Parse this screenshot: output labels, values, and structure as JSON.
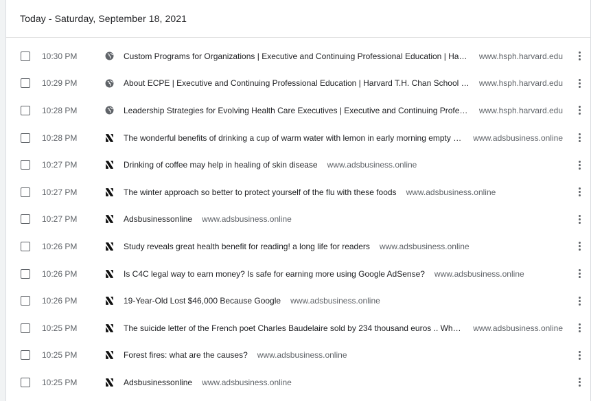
{
  "history": {
    "date_heading": "Today - Saturday, September 18, 2021",
    "rows": [
      {
        "time": "10:30 PM",
        "icon": "globe-icon",
        "title": "Custom Programs for Organizations | Executive and Continuing Professional Education | Harvard T.H. Chan School of Public Health",
        "domain": "www.hsph.harvard.edu"
      },
      {
        "time": "10:29 PM",
        "icon": "globe-icon",
        "title": "About ECPE | Executive and Continuing Professional Education | Harvard T.H. Chan School of Public Health",
        "domain": "www.hsph.harvard.edu"
      },
      {
        "time": "10:28 PM",
        "icon": "globe-icon",
        "title": "Leadership Strategies for Evolving Health Care Executives | Executive and Continuing Professional Education",
        "domain": "www.hsph.harvard.edu"
      },
      {
        "time": "10:28 PM",
        "icon": "adsbusiness-logo-icon",
        "title": "The wonderful benefits of drinking a cup of warm water with lemon in early morning empty stomach",
        "domain": "www.adsbusiness.online"
      },
      {
        "time": "10:27 PM",
        "icon": "adsbusiness-logo-icon",
        "title": "Drinking of coffee may help in healing of skin disease",
        "domain": "www.adsbusiness.online"
      },
      {
        "time": "10:27 PM",
        "icon": "adsbusiness-logo-icon",
        "title": "The winter approach so better to protect yourself of the flu with these foods",
        "domain": "www.adsbusiness.online"
      },
      {
        "time": "10:27 PM",
        "icon": "adsbusiness-logo-icon",
        "title": "Adsbusinessonline",
        "domain": "www.adsbusiness.online"
      },
      {
        "time": "10:26 PM",
        "icon": "adsbusiness-logo-icon",
        "title": "Study reveals great health benefit for reading! a long life for readers",
        "domain": "www.adsbusiness.online"
      },
      {
        "time": "10:26 PM",
        "icon": "adsbusiness-logo-icon",
        "title": "Is C4C legal way to earn money? Is safe for earning more using Google AdSense?",
        "domain": "www.adsbusiness.online"
      },
      {
        "time": "10:26 PM",
        "icon": "adsbusiness-logo-icon",
        "title": "19-Year-Old Lost $46,000 Because Google",
        "domain": "www.adsbusiness.online"
      },
      {
        "time": "10:25 PM",
        "icon": "adsbusiness-logo-icon",
        "title": "The suicide letter of the French poet Charles Baudelaire sold by 234 thousand euros .. What did he write in it",
        "domain": "www.adsbusiness.online"
      },
      {
        "time": "10:25 PM",
        "icon": "adsbusiness-logo-icon",
        "title": "Forest fires: what are the causes?",
        "domain": "www.adsbusiness.online"
      },
      {
        "time": "10:25 PM",
        "icon": "adsbusiness-logo-icon",
        "title": "Adsbusinessonline",
        "domain": "www.adsbusiness.online"
      }
    ]
  },
  "colors": {
    "text_primary": "#202124",
    "text_secondary": "#5f6368",
    "divider": "#e0e0e0"
  }
}
